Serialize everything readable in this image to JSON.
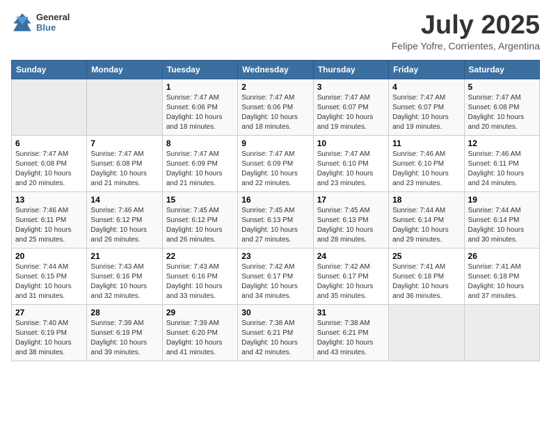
{
  "header": {
    "logo_line1": "General",
    "logo_line2": "Blue",
    "title": "July 2025",
    "subtitle": "Felipe Yofre, Corrientes, Argentina"
  },
  "calendar": {
    "days_of_week": [
      "Sunday",
      "Monday",
      "Tuesday",
      "Wednesday",
      "Thursday",
      "Friday",
      "Saturday"
    ],
    "weeks": [
      [
        {
          "day": null
        },
        {
          "day": null
        },
        {
          "day": "1",
          "sunrise": "Sunrise: 7:47 AM",
          "sunset": "Sunset: 6:06 PM",
          "daylight": "Daylight: 10 hours and 18 minutes."
        },
        {
          "day": "2",
          "sunrise": "Sunrise: 7:47 AM",
          "sunset": "Sunset: 6:06 PM",
          "daylight": "Daylight: 10 hours and 18 minutes."
        },
        {
          "day": "3",
          "sunrise": "Sunrise: 7:47 AM",
          "sunset": "Sunset: 6:07 PM",
          "daylight": "Daylight: 10 hours and 19 minutes."
        },
        {
          "day": "4",
          "sunrise": "Sunrise: 7:47 AM",
          "sunset": "Sunset: 6:07 PM",
          "daylight": "Daylight: 10 hours and 19 minutes."
        },
        {
          "day": "5",
          "sunrise": "Sunrise: 7:47 AM",
          "sunset": "Sunset: 6:08 PM",
          "daylight": "Daylight: 10 hours and 20 minutes."
        }
      ],
      [
        {
          "day": "6",
          "sunrise": "Sunrise: 7:47 AM",
          "sunset": "Sunset: 6:08 PM",
          "daylight": "Daylight: 10 hours and 20 minutes."
        },
        {
          "day": "7",
          "sunrise": "Sunrise: 7:47 AM",
          "sunset": "Sunset: 6:08 PM",
          "daylight": "Daylight: 10 hours and 21 minutes."
        },
        {
          "day": "8",
          "sunrise": "Sunrise: 7:47 AM",
          "sunset": "Sunset: 6:09 PM",
          "daylight": "Daylight: 10 hours and 21 minutes."
        },
        {
          "day": "9",
          "sunrise": "Sunrise: 7:47 AM",
          "sunset": "Sunset: 6:09 PM",
          "daylight": "Daylight: 10 hours and 22 minutes."
        },
        {
          "day": "10",
          "sunrise": "Sunrise: 7:47 AM",
          "sunset": "Sunset: 6:10 PM",
          "daylight": "Daylight: 10 hours and 23 minutes."
        },
        {
          "day": "11",
          "sunrise": "Sunrise: 7:46 AM",
          "sunset": "Sunset: 6:10 PM",
          "daylight": "Daylight: 10 hours and 23 minutes."
        },
        {
          "day": "12",
          "sunrise": "Sunrise: 7:46 AM",
          "sunset": "Sunset: 6:11 PM",
          "daylight": "Daylight: 10 hours and 24 minutes."
        }
      ],
      [
        {
          "day": "13",
          "sunrise": "Sunrise: 7:46 AM",
          "sunset": "Sunset: 6:11 PM",
          "daylight": "Daylight: 10 hours and 25 minutes."
        },
        {
          "day": "14",
          "sunrise": "Sunrise: 7:46 AM",
          "sunset": "Sunset: 6:12 PM",
          "daylight": "Daylight: 10 hours and 26 minutes."
        },
        {
          "day": "15",
          "sunrise": "Sunrise: 7:45 AM",
          "sunset": "Sunset: 6:12 PM",
          "daylight": "Daylight: 10 hours and 26 minutes."
        },
        {
          "day": "16",
          "sunrise": "Sunrise: 7:45 AM",
          "sunset": "Sunset: 6:13 PM",
          "daylight": "Daylight: 10 hours and 27 minutes."
        },
        {
          "day": "17",
          "sunrise": "Sunrise: 7:45 AM",
          "sunset": "Sunset: 6:13 PM",
          "daylight": "Daylight: 10 hours and 28 minutes."
        },
        {
          "day": "18",
          "sunrise": "Sunrise: 7:44 AM",
          "sunset": "Sunset: 6:14 PM",
          "daylight": "Daylight: 10 hours and 29 minutes."
        },
        {
          "day": "19",
          "sunrise": "Sunrise: 7:44 AM",
          "sunset": "Sunset: 6:14 PM",
          "daylight": "Daylight: 10 hours and 30 minutes."
        }
      ],
      [
        {
          "day": "20",
          "sunrise": "Sunrise: 7:44 AM",
          "sunset": "Sunset: 6:15 PM",
          "daylight": "Daylight: 10 hours and 31 minutes."
        },
        {
          "day": "21",
          "sunrise": "Sunrise: 7:43 AM",
          "sunset": "Sunset: 6:16 PM",
          "daylight": "Daylight: 10 hours and 32 minutes."
        },
        {
          "day": "22",
          "sunrise": "Sunrise: 7:43 AM",
          "sunset": "Sunset: 6:16 PM",
          "daylight": "Daylight: 10 hours and 33 minutes."
        },
        {
          "day": "23",
          "sunrise": "Sunrise: 7:42 AM",
          "sunset": "Sunset: 6:17 PM",
          "daylight": "Daylight: 10 hours and 34 minutes."
        },
        {
          "day": "24",
          "sunrise": "Sunrise: 7:42 AM",
          "sunset": "Sunset: 6:17 PM",
          "daylight": "Daylight: 10 hours and 35 minutes."
        },
        {
          "day": "25",
          "sunrise": "Sunrise: 7:41 AM",
          "sunset": "Sunset: 6:18 PM",
          "daylight": "Daylight: 10 hours and 36 minutes."
        },
        {
          "day": "26",
          "sunrise": "Sunrise: 7:41 AM",
          "sunset": "Sunset: 6:18 PM",
          "daylight": "Daylight: 10 hours and 37 minutes."
        }
      ],
      [
        {
          "day": "27",
          "sunrise": "Sunrise: 7:40 AM",
          "sunset": "Sunset: 6:19 PM",
          "daylight": "Daylight: 10 hours and 38 minutes."
        },
        {
          "day": "28",
          "sunrise": "Sunrise: 7:39 AM",
          "sunset": "Sunset: 6:19 PM",
          "daylight": "Daylight: 10 hours and 39 minutes."
        },
        {
          "day": "29",
          "sunrise": "Sunrise: 7:39 AM",
          "sunset": "Sunset: 6:20 PM",
          "daylight": "Daylight: 10 hours and 41 minutes."
        },
        {
          "day": "30",
          "sunrise": "Sunrise: 7:38 AM",
          "sunset": "Sunset: 6:21 PM",
          "daylight": "Daylight: 10 hours and 42 minutes."
        },
        {
          "day": "31",
          "sunrise": "Sunrise: 7:38 AM",
          "sunset": "Sunset: 6:21 PM",
          "daylight": "Daylight: 10 hours and 43 minutes."
        },
        {
          "day": null
        },
        {
          "day": null
        }
      ]
    ]
  }
}
